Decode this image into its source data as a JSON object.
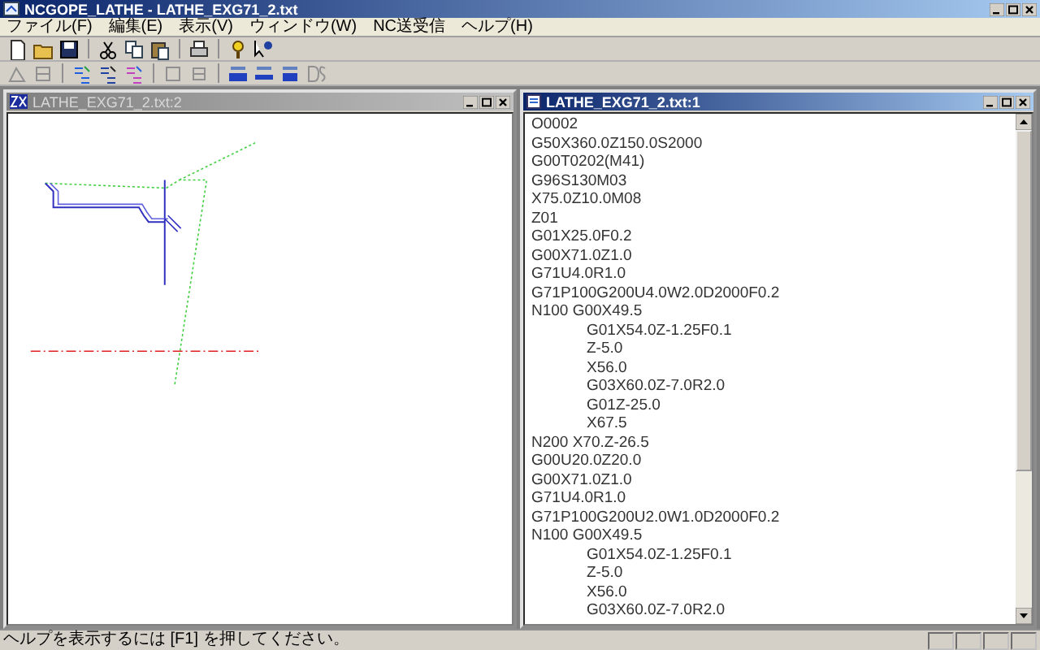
{
  "window": {
    "title": "NCGOPE_LATHE - LATHE_EXG71_2.txt"
  },
  "menu": [
    {
      "label": "ファイル(F)"
    },
    {
      "label": "編集(E)"
    },
    {
      "label": "表示(V)"
    },
    {
      "label": "ウィンドウ(W)"
    },
    {
      "label": "NC送受信"
    },
    {
      "label": "ヘルプ(H)"
    }
  ],
  "child_windows": [
    {
      "kind": "drawing",
      "title": "LATHE_EXG71_2.txt:2",
      "active": false
    },
    {
      "kind": "text",
      "title": "LATHE_EXG71_2.txt:1",
      "active": true,
      "lines": [
        {
          "text": "O0002"
        },
        {
          "text": "G50X360.0Z150.0S2000"
        },
        {
          "text": "G00T0202(M41)"
        },
        {
          "text": "G96S130M03"
        },
        {
          "text": "X75.0Z10.0M08"
        },
        {
          "text": "Z01"
        },
        {
          "text": "G01X25.0F0.2"
        },
        {
          "text": "G00X71.0Z1.0"
        },
        {
          "text": "G71U4.0R1.0"
        },
        {
          "text": "G71P100G200U4.0W2.0D2000F0.2"
        },
        {
          "text": "N100 G00X49.5",
          "children": [
            {
              "text": "G01X54.0Z-1.25F0.1"
            },
            {
              "text": "Z-5.0"
            },
            {
              "text": "X56.0"
            },
            {
              "text": "G03X60.0Z-7.0R2.0"
            },
            {
              "text": "G01Z-25.0"
            },
            {
              "text": "X67.5"
            }
          ]
        },
        {
          "text": "N200 X70.Z-26.5"
        },
        {
          "text": "G00U20.0Z20.0"
        },
        {
          "text": "G00X71.0Z1.0"
        },
        {
          "text": "G71U4.0R1.0"
        },
        {
          "text": "G71P100G200U2.0W1.0D2000F0.2"
        },
        {
          "text": "N100 G00X49.5",
          "children": [
            {
              "text": "G01X54.0Z-1.25F0.1"
            },
            {
              "text": "Z-5.0"
            },
            {
              "text": "X56.0"
            },
            {
              "text": "G03X60.0Z-7.0R2.0"
            }
          ]
        }
      ]
    }
  ],
  "status_bar": {
    "text": "ヘルプを表示するには [F1] を押してください。"
  }
}
